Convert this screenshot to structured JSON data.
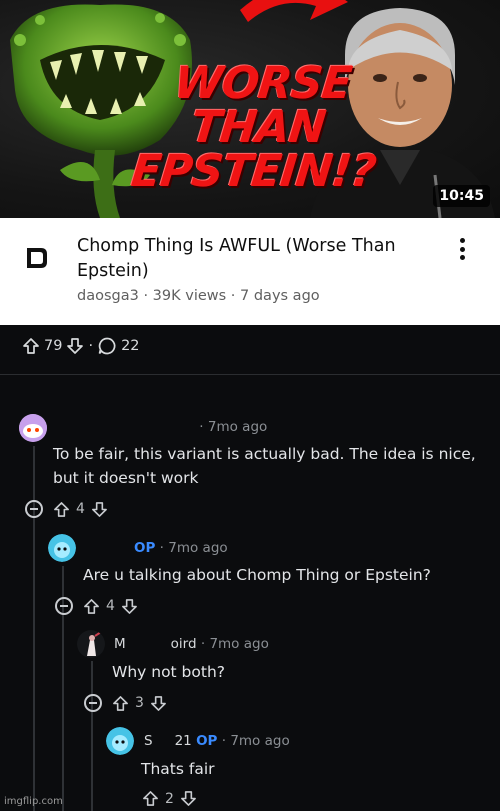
{
  "thumbnail": {
    "title_lines": [
      "WORSE",
      "THAN",
      "EPSTEIN!?"
    ],
    "duration": "10:45",
    "colors": {
      "title": "#f01414",
      "arrow": "#e81010"
    }
  },
  "video": {
    "title": "Chomp Thing Is AWFUL (Worse Than Epstein)",
    "channel": "daosga3",
    "views": "39K views",
    "age": "7 days ago",
    "meta_sep": " · ",
    "menu_icon": "kebab-menu-icon"
  },
  "post": {
    "upvotes": "79",
    "dot": "·",
    "comments": "22"
  },
  "comments": [
    {
      "user": "",
      "op": "",
      "time": "7mo ago",
      "body": "To be fair, this variant is actually bad. The idea is nice, but it doesn't work",
      "votes": "4"
    },
    {
      "user": "",
      "op": "OP",
      "time": "7mo ago",
      "body": "Are u talking about Chomp Thing or Epstein?",
      "votes": "4"
    },
    {
      "user": "M",
      "user_tail": "oird",
      "op": "",
      "time": "7mo ago",
      "body": "Why not both?",
      "votes": "3"
    },
    {
      "user": "S",
      "user_tail": "21",
      "op": "OP",
      "time": "7mo ago",
      "body": "Thats fair",
      "votes": "2"
    }
  ],
  "watermark": "imgflip.com",
  "colors": {
    "background": "#0b0c0e",
    "op_badge": "#3a8bff",
    "text": "#e3e5e8"
  }
}
